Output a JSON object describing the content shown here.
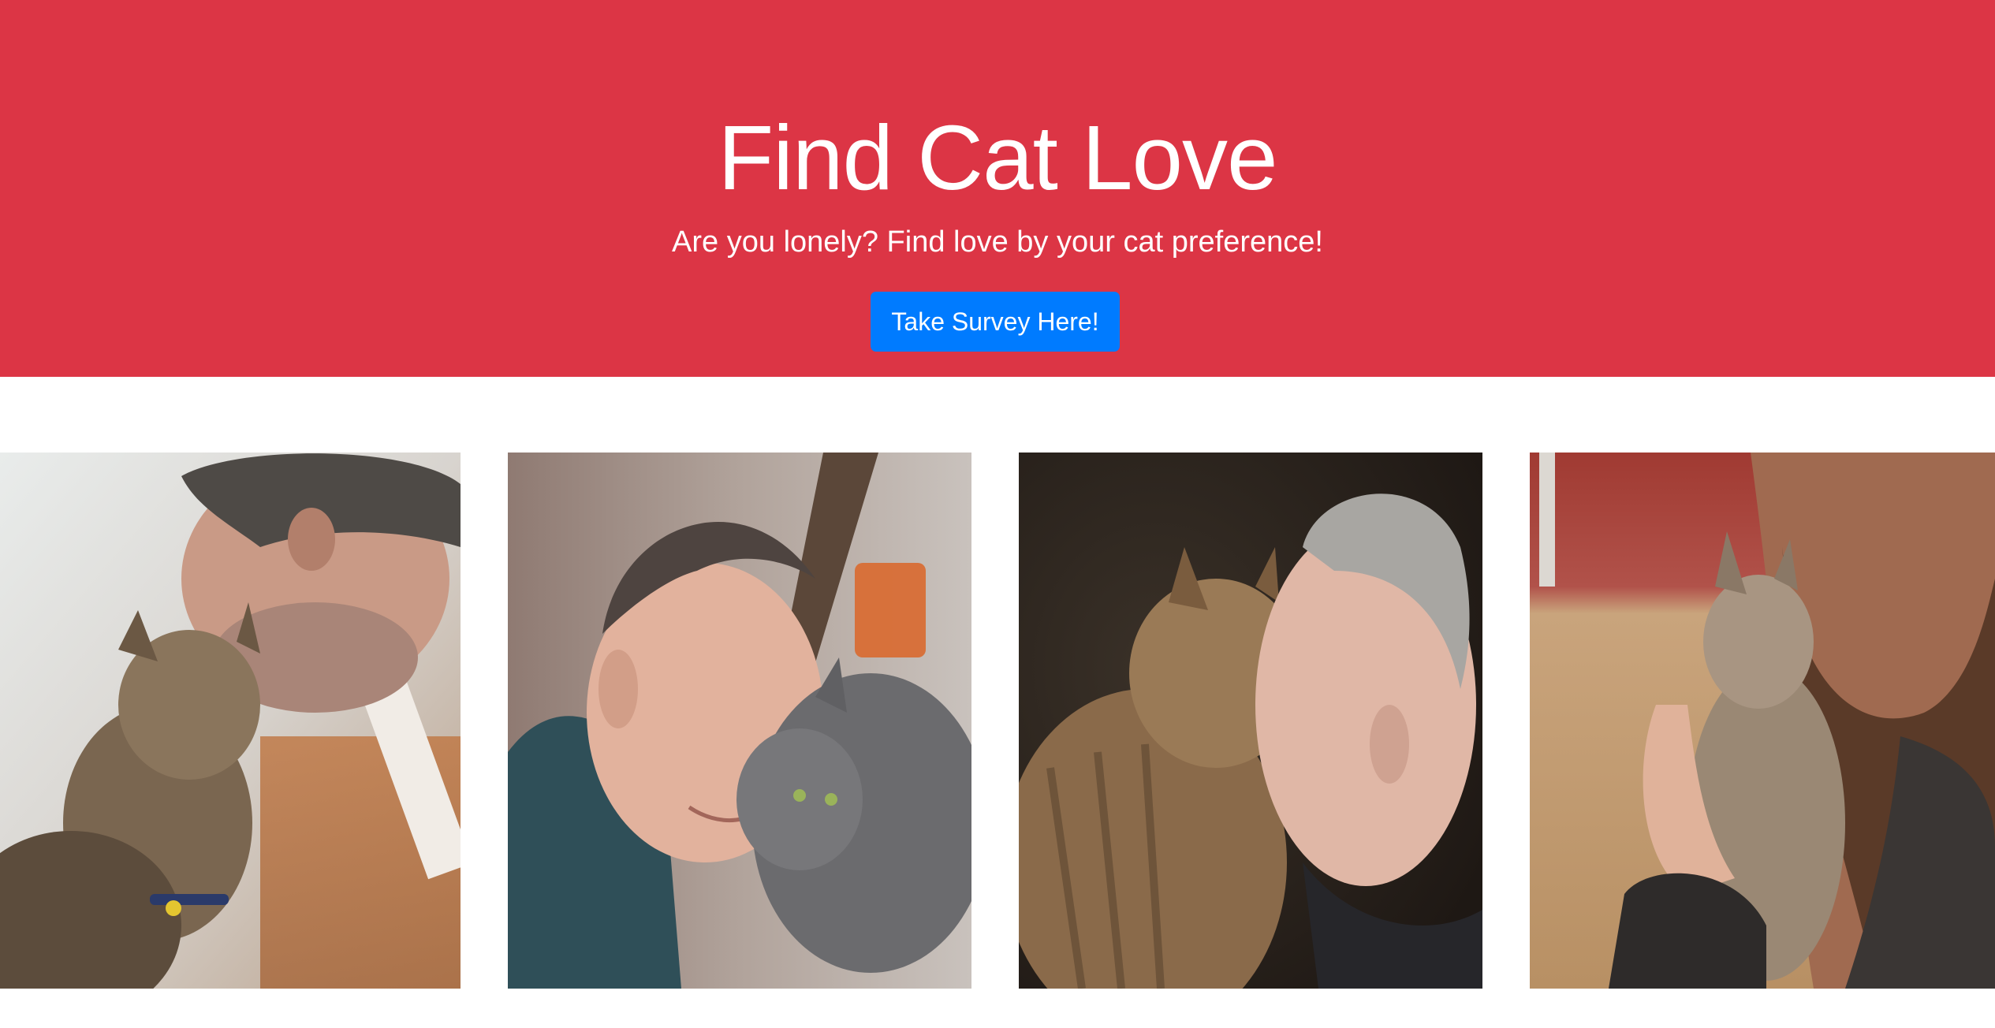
{
  "hero": {
    "title": "Find Cat Love",
    "subtitle": "Are you lonely? Find love by your cat preference!",
    "button_label": "Take Survey Here!"
  },
  "colors": {
    "hero_background": "#dc3545",
    "button_primary": "#007bff",
    "text_on_hero": "#ffffff"
  },
  "gallery": {
    "photos": [
      {
        "description_name": "man-nose-to-nose-with-tabby-cat"
      },
      {
        "description_name": "young-man-head-to-head-with-gray-cat"
      },
      {
        "description_name": "gray-haired-man-forehead-to-tabby-cat"
      },
      {
        "description_name": "bearded-man-hugging-tabby-cat"
      }
    ]
  }
}
